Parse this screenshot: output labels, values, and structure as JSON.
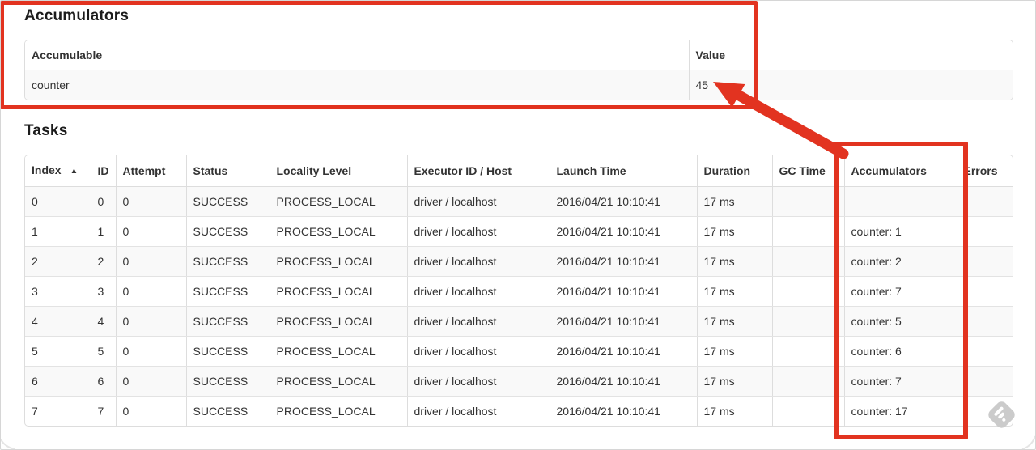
{
  "accumulators_section": {
    "title": "Accumulators",
    "table": {
      "headers": [
        "Accumulable",
        "Value"
      ],
      "rows": [
        [
          "counter",
          "45"
        ]
      ]
    }
  },
  "tasks_section": {
    "title": "Tasks",
    "table": {
      "headers": [
        "Index",
        "ID",
        "Attempt",
        "Status",
        "Locality Level",
        "Executor ID / Host",
        "Launch Time",
        "Duration",
        "GC Time",
        "Accumulators",
        "Errors"
      ],
      "sort_indicator": "▲",
      "sorted_column": "Index",
      "rows": [
        [
          "0",
          "0",
          "0",
          "SUCCESS",
          "PROCESS_LOCAL",
          "driver / localhost",
          "2016/04/21 10:10:41",
          "17 ms",
          "",
          "",
          ""
        ],
        [
          "1",
          "1",
          "0",
          "SUCCESS",
          "PROCESS_LOCAL",
          "driver / localhost",
          "2016/04/21 10:10:41",
          "17 ms",
          "",
          "counter: 1",
          ""
        ],
        [
          "2",
          "2",
          "0",
          "SUCCESS",
          "PROCESS_LOCAL",
          "driver / localhost",
          "2016/04/21 10:10:41",
          "17 ms",
          "",
          "counter: 2",
          ""
        ],
        [
          "3",
          "3",
          "0",
          "SUCCESS",
          "PROCESS_LOCAL",
          "driver / localhost",
          "2016/04/21 10:10:41",
          "17 ms",
          "",
          "counter: 7",
          ""
        ],
        [
          "4",
          "4",
          "0",
          "SUCCESS",
          "PROCESS_LOCAL",
          "driver / localhost",
          "2016/04/21 10:10:41",
          "17 ms",
          "",
          "counter: 5",
          ""
        ],
        [
          "5",
          "5",
          "0",
          "SUCCESS",
          "PROCESS_LOCAL",
          "driver / localhost",
          "2016/04/21 10:10:41",
          "17 ms",
          "",
          "counter: 6",
          ""
        ],
        [
          "6",
          "6",
          "0",
          "SUCCESS",
          "PROCESS_LOCAL",
          "driver / localhost",
          "2016/04/21 10:10:41",
          "17 ms",
          "",
          "counter: 7",
          ""
        ],
        [
          "7",
          "7",
          "0",
          "SUCCESS",
          "PROCESS_LOCAL",
          "driver / localhost",
          "2016/04/21 10:10:41",
          "17 ms",
          "",
          "counter: 17",
          ""
        ]
      ]
    }
  },
  "annotations": {
    "highlight_color": "#e23320",
    "arrow_points_to": "45"
  }
}
